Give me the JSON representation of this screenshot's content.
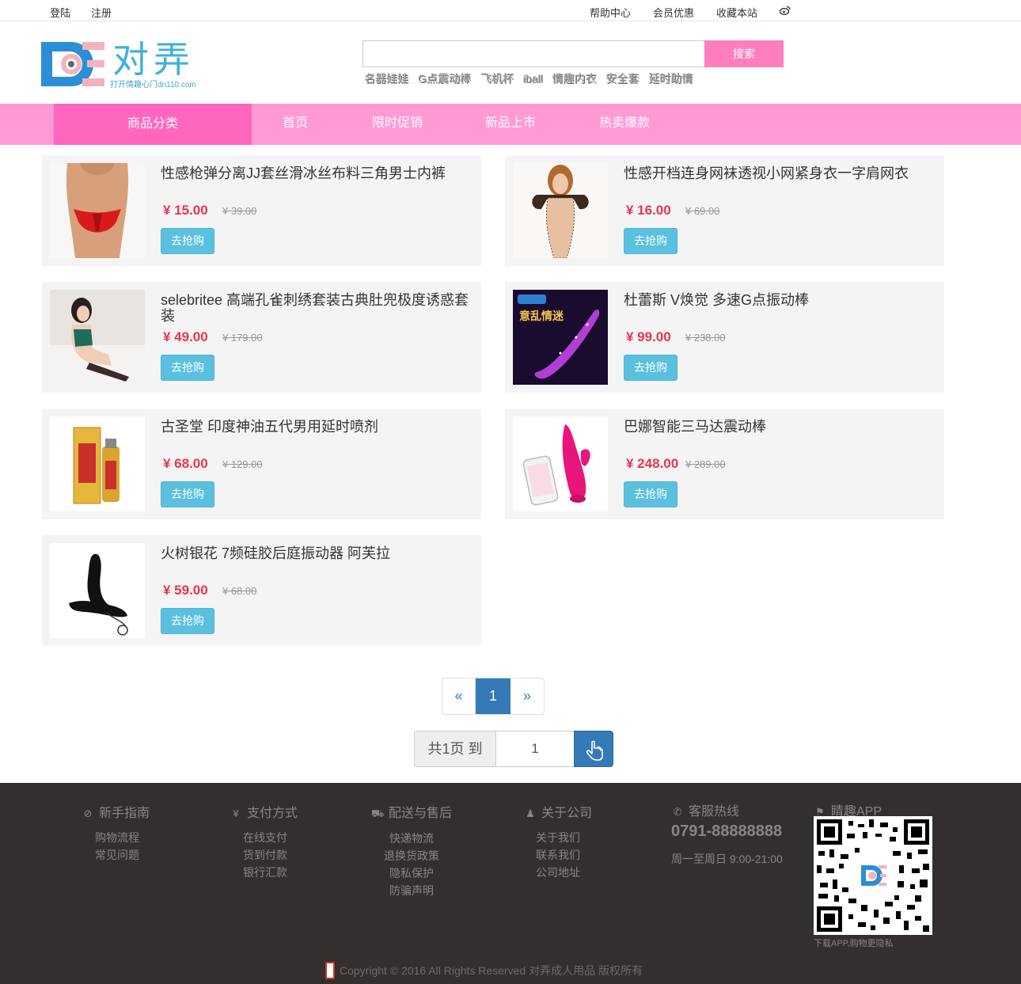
{
  "topbar": {
    "login": "登陆",
    "register": "注册",
    "help": "帮助中心",
    "member_deals": "会员优惠",
    "bookmark": "收藏本站",
    "weibo_icon": "weibo-icon"
  },
  "header": {
    "logo_title": "对弄",
    "logo_sub": "打开情趣心门dn110.com",
    "search_placeholder": "",
    "search_button": "搜索",
    "hotwords": [
      "名器娃娃",
      "G点震动棒",
      "飞机杯",
      "iball",
      "情趣内衣",
      "安全套",
      "延时助情"
    ]
  },
  "nav": {
    "category": "商品分类",
    "items": [
      "首页",
      "限时促销",
      "新品上市",
      "热卖爆款"
    ]
  },
  "products": [
    {
      "title": "性感枪弹分离JJ套丝滑冰丝布料三角男士内裤",
      "price": "¥ 15.00",
      "old_price": "¥ 39.00",
      "buy": "去抢购",
      "image": "red-briefs-photo"
    },
    {
      "title": "性感开档连身网袜透视小网紧身衣一字肩网衣",
      "price": "¥ 16.00",
      "old_price": "¥ 69.00",
      "buy": "去抢购",
      "image": "fishnet-bodysuit-photo"
    },
    {
      "title": "selebritee 高端孔雀刺绣套装古典肚兜极度诱惑套装",
      "price": "¥ 49.00",
      "old_price": "¥ 179.00",
      "buy": "去抢购",
      "image": "embroidered-lingerie-photo"
    },
    {
      "title": "杜蕾斯 V焕觉 多速G点振动棒",
      "price": "¥ 99.00",
      "old_price": "¥ 238.00",
      "buy": "去抢购",
      "image": "purple-vibrator-photo"
    },
    {
      "title": "古圣堂 印度神油五代男用延时喷剂",
      "price": "¥ 68.00",
      "old_price": "¥ 129.00",
      "buy": "去抢购",
      "image": "spray-bottle-photo"
    },
    {
      "title": "巴娜智能三马达震动棒",
      "price": "¥ 248.00",
      "old_price": "¥ 289.00",
      "buy": "去抢购",
      "image": "pink-vibrator-photo"
    },
    {
      "title": "火树银花 7频硅胶后庭振动器 阿芙拉",
      "price": "¥ 59.00",
      "old_price": "¥ 68.00",
      "buy": "去抢购",
      "image": "black-massager-photo"
    }
  ],
  "pagination": {
    "prev": "«",
    "current": "1",
    "next": "»",
    "total_label": "共1页 到",
    "goto_value": "1"
  },
  "footer": {
    "columns": [
      {
        "heading": "新手指南",
        "icon": "compass-icon",
        "links": [
          "购物流程",
          "常见问题"
        ]
      },
      {
        "heading": "支付方式",
        "icon": "yen-icon",
        "links": [
          "在线支付",
          "货到付款",
          "银行汇款"
        ]
      },
      {
        "heading": "配送与售后",
        "icon": "truck-icon",
        "links": [
          "快递物流",
          "退换货政策",
          "隐私保护",
          "防骗声明"
        ]
      },
      {
        "heading": "关于公司",
        "icon": "user-plus-icon",
        "links": [
          "关于我们",
          "联系我们",
          "公司地址"
        ]
      }
    ],
    "hotline_heading": "客服热线",
    "hotline_number": "0791-88888888",
    "hours": "周一至周日 9:00-21:00",
    "app_heading": "睛趣APP",
    "qr_caption": "下载APP,购物更隐私",
    "copyright": "Copyright © 2016 All Rights Reserved 对弄成人用品 版权所有"
  },
  "colors": {
    "nav_bg": "#ff9ad5",
    "nav_active": "#ff66be",
    "price": "#e8354f",
    "buy_button": "#5bc0de",
    "pager_active": "#337ab7",
    "footer_bg": "#342f2f"
  }
}
